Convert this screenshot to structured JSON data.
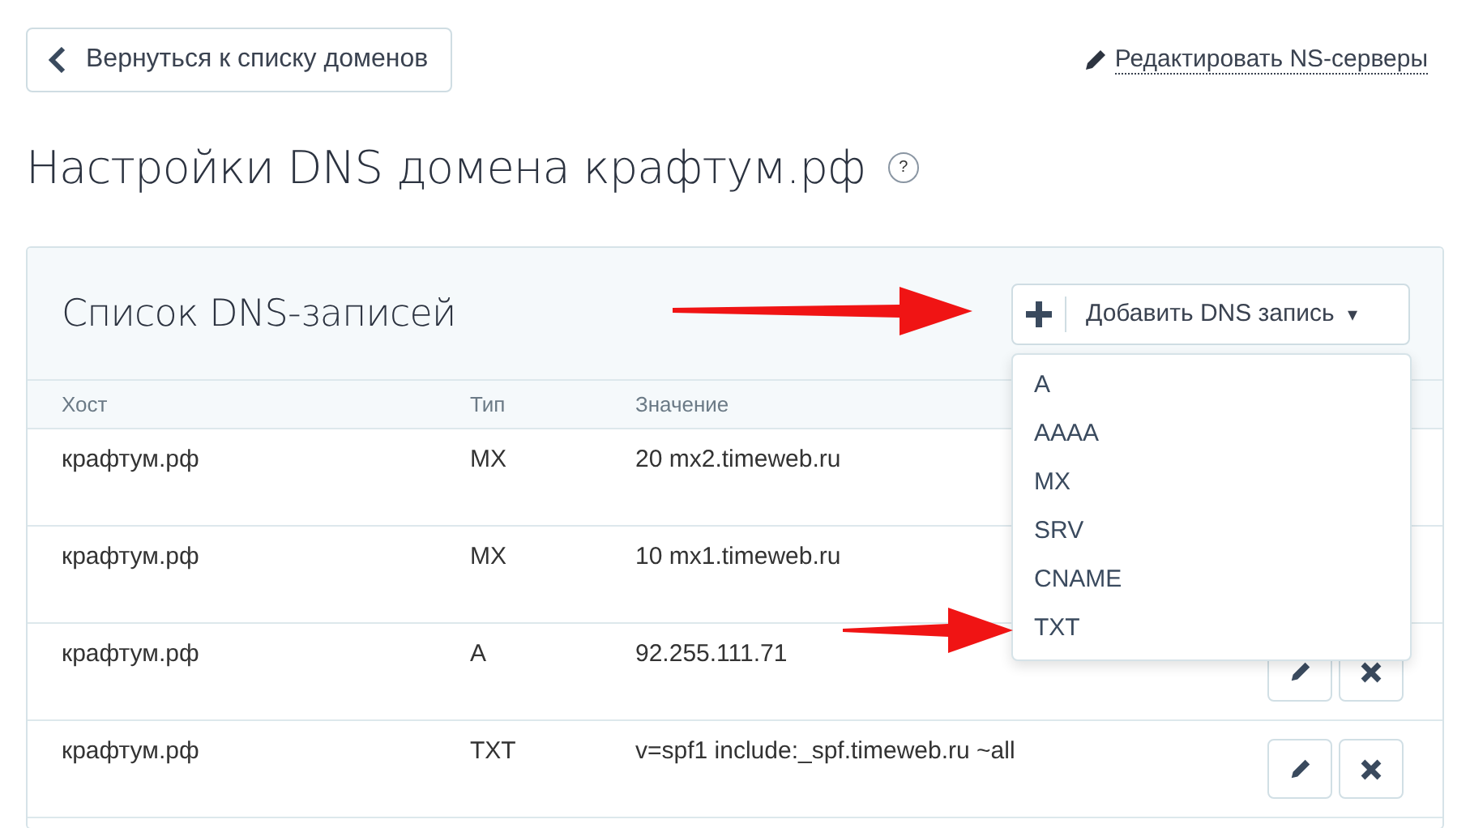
{
  "back_button": {
    "label": "Вернуться к списку доменов"
  },
  "edit_ns_link": {
    "label": "Редактировать NS-серверы"
  },
  "page_title": "Настройки DNS домена крафтум.рф",
  "help_badge": "?",
  "panel": {
    "title": "Список DNS-записей",
    "add_button": {
      "label": "Добавить DNS запись",
      "caret": "▾",
      "expanded": true
    },
    "dropdown_items": [
      {
        "label": "A"
      },
      {
        "label": "AAAA"
      },
      {
        "label": "MX"
      },
      {
        "label": "SRV"
      },
      {
        "label": "CNAME"
      },
      {
        "label": "TXT"
      }
    ],
    "table": {
      "columns": [
        "Хост",
        "Тип",
        "Значение"
      ],
      "rows": [
        {
          "host": "крафтум.рф",
          "type": "MX",
          "value": "20 mx2.timeweb.ru"
        },
        {
          "host": "крафтум.рф",
          "type": "MX",
          "value": "10 mx1.timeweb.ru"
        },
        {
          "host": "крафтум.рф",
          "type": "A",
          "value": "92.255.111.71"
        },
        {
          "host": "крафтум.рф",
          "type": "TXT",
          "value": "v=spf1 include:_spf.timeweb.ru ~all"
        }
      ]
    }
  }
}
